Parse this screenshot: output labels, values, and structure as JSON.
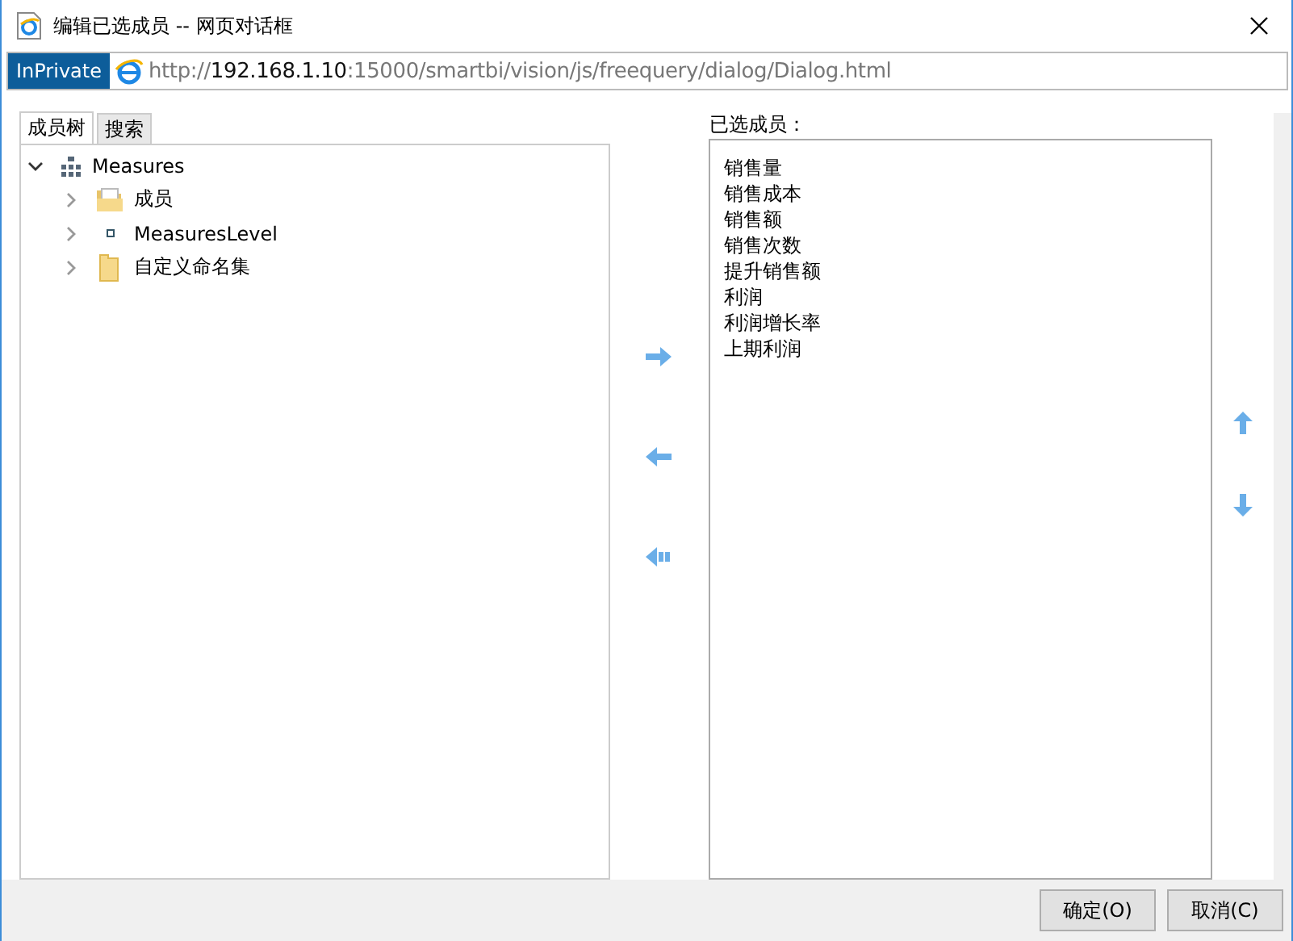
{
  "window": {
    "title": "编辑已选成员 -- 网页对话框"
  },
  "address_bar": {
    "badge": "InPrivate",
    "url_parts": [
      "http://",
      "192.168.1.10",
      ":15000/smartbi/vision/js/freequery/dialog/Dialog.html"
    ]
  },
  "tabs": [
    {
      "label": "成员树",
      "selected": true
    },
    {
      "label": "搜索",
      "selected": false
    }
  ],
  "tree": [
    {
      "label": "Measures",
      "kind": "hierarchy",
      "expanded": true,
      "children": [
        {
          "label": "成员",
          "kind": "open-folder",
          "expanded": false
        },
        {
          "label": "MeasuresLevel",
          "kind": "level",
          "expanded": false
        },
        {
          "label": "自定义命名集",
          "kind": "folder",
          "expanded": false
        }
      ]
    }
  ],
  "selected_members": {
    "label": "已选成员：",
    "items": [
      "销售量",
      "销售成本",
      "销售额",
      "销售次数",
      "提升销售额",
      "利润",
      "利润增长率",
      "上期利润"
    ]
  },
  "buttons": [
    "确定(O)",
    "取消(C)"
  ]
}
